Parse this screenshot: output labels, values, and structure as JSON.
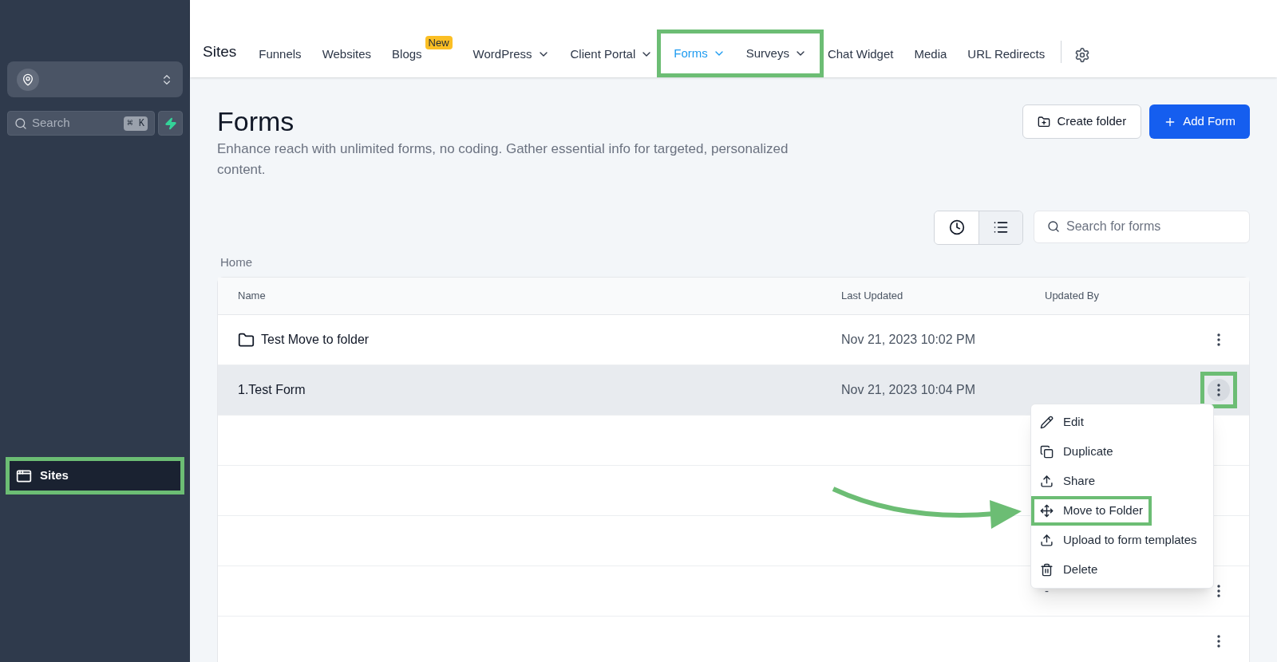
{
  "sidebar": {
    "search": {
      "placeholder": "Search",
      "shortcut": "⌘ K"
    },
    "items": [
      {
        "label": "Sites",
        "selected": true,
        "highlighted": true
      }
    ]
  },
  "nav": {
    "title": "Sites",
    "items": [
      {
        "label": "Funnels",
        "selected": false,
        "dropdown": false,
        "highlighted": false
      },
      {
        "label": "Websites",
        "selected": false,
        "dropdown": false,
        "highlighted": false
      },
      {
        "label": "Blogs",
        "badge": "New",
        "selected": false,
        "dropdown": false,
        "highlighted": false
      },
      {
        "label": "WordPress",
        "selected": false,
        "dropdown": true,
        "highlighted": false
      },
      {
        "label": "Client Portal",
        "selected": false,
        "dropdown": true,
        "highlighted": false
      },
      {
        "label": "Forms",
        "selected": true,
        "dropdown": true,
        "highlighted": true
      },
      {
        "label": "Surveys",
        "selected": false,
        "dropdown": true,
        "highlighted": true
      },
      {
        "label": "Chat Widget",
        "selected": false,
        "dropdown": false,
        "highlighted": false
      },
      {
        "label": "Media",
        "selected": false,
        "dropdown": false,
        "highlighted": false
      },
      {
        "label": "URL Redirects",
        "selected": false,
        "dropdown": false,
        "highlighted": false
      }
    ]
  },
  "page": {
    "title": "Forms",
    "subtitle": "Enhance reach with unlimited forms, no coding. Gather essential info for targeted, personalized content.",
    "buttons": [
      {
        "label": "Create folder",
        "kind": "secondary"
      },
      {
        "label": "Add Form",
        "kind": "primary"
      }
    ]
  },
  "view_toggle": [
    {
      "kind": "recent",
      "selected": false
    },
    {
      "kind": "list",
      "selected": true
    }
  ],
  "search": {
    "placeholder": "Search for forms"
  },
  "breadcrumb": "Home",
  "table": {
    "columns": [
      "Name",
      "Last Updated",
      "Updated By"
    ],
    "rows": [
      {
        "kind": "folder",
        "name": "Test Move to folder",
        "last_updated": "Nov 21, 2023 10:02 PM",
        "selected": false,
        "menu_button": true,
        "highlighted": false
      },
      {
        "kind": "form",
        "name": "1.Test Form",
        "last_updated": "Nov 21, 2023 10:04 PM",
        "selected": true,
        "menu_button": true,
        "highlighted": true
      },
      {
        "kind": "form",
        "selected": false,
        "menu_button": false,
        "highlighted": false
      },
      {
        "kind": "form",
        "selected": false,
        "menu_button": false,
        "highlighted": false
      },
      {
        "kind": "form",
        "selected": false,
        "menu_button": false,
        "highlighted": false
      },
      {
        "kind": "form",
        "updated_by": "-",
        "selected": false,
        "menu_button": true,
        "highlighted": false
      },
      {
        "kind": "form",
        "selected": false,
        "menu_button": true,
        "highlighted": false
      }
    ]
  },
  "context_menu": [
    {
      "kind": "edit",
      "label": "Edit",
      "highlighted": false
    },
    {
      "kind": "duplicate",
      "label": "Duplicate",
      "highlighted": false
    },
    {
      "kind": "share",
      "label": "Share",
      "highlighted": false
    },
    {
      "kind": "move",
      "label": "Move to Folder",
      "highlighted": true
    },
    {
      "kind": "upload",
      "label": "Upload to form templates",
      "highlighted": false
    },
    {
      "kind": "delete",
      "label": "Delete",
      "highlighted": false
    }
  ]
}
